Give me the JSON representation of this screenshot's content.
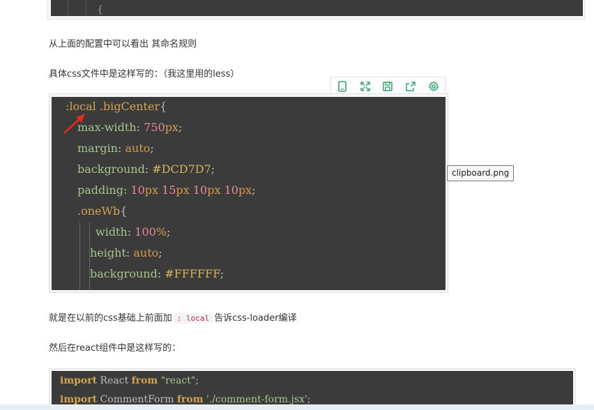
{
  "top_code": {
    "visible_text": "{"
  },
  "para1": "从上面的配置中可以看出 其命名规则",
  "para2": "具体css文件中是这样写的：（我这里用的less）",
  "image_toolbar": {
    "icons": [
      "mobile-icon",
      "fullscreen-icon",
      "save-icon",
      "share-icon",
      "settings-icon"
    ]
  },
  "tooltip": "clipboard.png",
  "image_code": {
    "line1_a": ":local",
    "line1_b": " .bigCenter",
    "line1_c": "{",
    "line2_prop": "max-width",
    "line2_colon": ": ",
    "line2_num": "750",
    "line2_unit": "px",
    "line2_semi": ";",
    "line3_prop": "margin",
    "line3_colon": ": ",
    "line3_val": "auto",
    "line3_semi": ";",
    "line4_prop": "background",
    "line4_colon": ": ",
    "line4_val": "#DCD7D7",
    "line4_semi": ";",
    "line5_prop": "padding",
    "line5_colon": ": ",
    "line5_n1": "10",
    "line5_u1": "px",
    "line5_n2": " 15",
    "line5_u2": "px",
    "line5_n3": " 10",
    "line5_u3": "px",
    "line5_n4": " 10",
    "line5_u4": "px",
    "line5_semi": ";",
    "line6_sel": ".oneWb",
    "line6_brace": "{",
    "line7_prop": "width",
    "line7_colon": ": ",
    "line7_num": "100",
    "line7_unit": "%",
    "line7_semi": ";",
    "line8_prop": "height",
    "line8_colon": ": ",
    "line8_val": "auto",
    "line8_semi": ";",
    "line9_prop": "background",
    "line9_colon": ": ",
    "line9_val": "#FFFFFF",
    "line9_semi": ";"
  },
  "para3_before": "就是在以前的css基础上前面加",
  "para3_code": ": local",
  "para3_after": "告诉css-loader编译",
  "para4": "然后在react组件中是这样写的：",
  "bottom_code": {
    "l1_kw": "import",
    "l1_id": " React ",
    "l1_from": "from",
    "l1_str": " \"react\"",
    "l1_semi": ";",
    "l2_kw": "import",
    "l2_id": " CommentForm ",
    "l2_from": "from",
    "l2_str": " './comment-form.jsx'",
    "l2_semi": ";"
  },
  "colors": {
    "code_bg": "#3b3b3b",
    "selector": "#d4a34f",
    "property": "#b5cea8",
    "number": "#e58a9b",
    "icon_green": "#2fa56b",
    "arrow_red": "#e8281d"
  }
}
